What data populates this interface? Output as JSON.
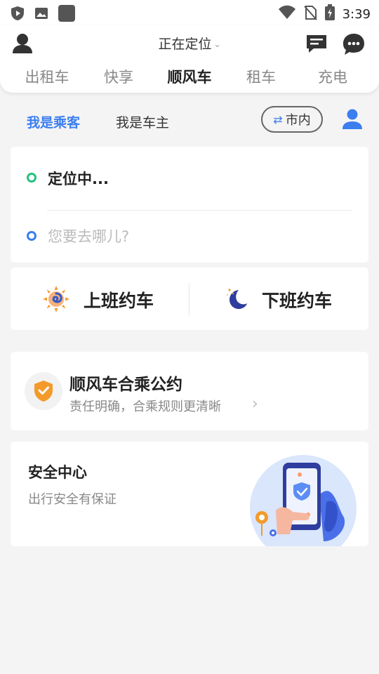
{
  "status_bar": {
    "time": "3:39",
    "left_icons": [
      "shield-app-icon",
      "image-icon",
      "app-square-icon"
    ],
    "right_icons": [
      "wifi-icon",
      "no-sim-icon",
      "battery-charging-icon"
    ]
  },
  "header": {
    "location_label": "正在定位",
    "mode_tabs": [
      {
        "label": "出租车",
        "active": false
      },
      {
        "label": "快享",
        "active": false
      },
      {
        "label": "顺风车",
        "active": true
      },
      {
        "label": "租车",
        "active": false
      },
      {
        "label": "充电",
        "active": false
      }
    ]
  },
  "role": {
    "passenger": "我是乘客",
    "driver": "我是车主",
    "city_scope": "市内"
  },
  "address": {
    "from": "定位中...",
    "to_placeholder": "您要去哪儿?"
  },
  "commute": {
    "to_work": "上班约车",
    "off_work": "下班约车"
  },
  "pact": {
    "title": "顺风车合乘公约",
    "subtitle": "责任明确，合乘规则更清晰"
  },
  "safety": {
    "title": "安全中心",
    "subtitle": "出行安全有保证"
  },
  "colors": {
    "accent": "#3b7ef0",
    "green": "#23c17e",
    "orange": "#f39a2b"
  }
}
